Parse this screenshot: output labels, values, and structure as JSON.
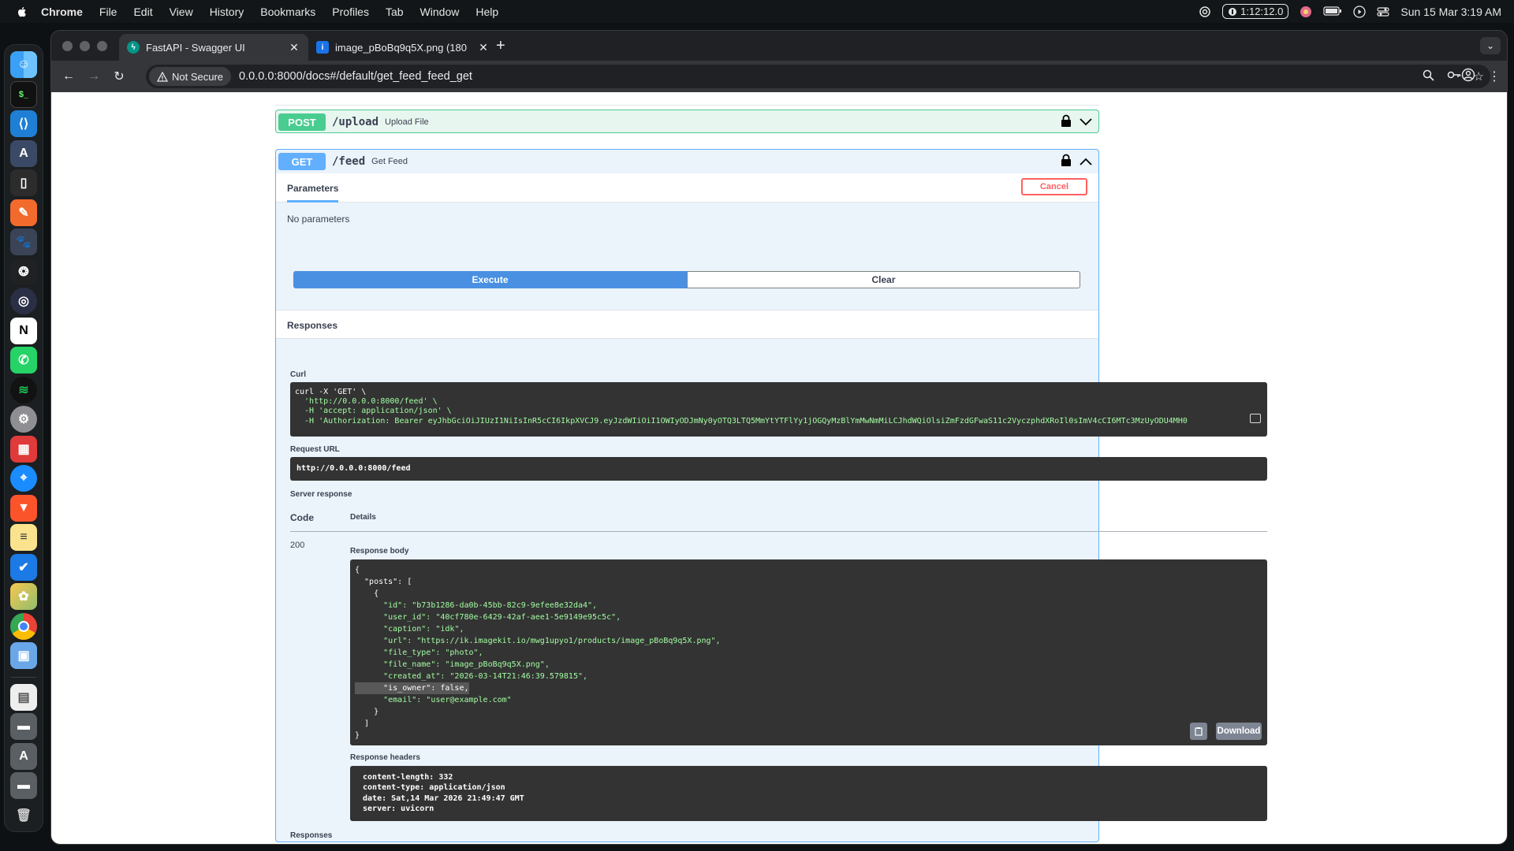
{
  "menubar": {
    "app_name": "Chrome",
    "items": [
      "File",
      "Edit",
      "View",
      "History",
      "Bookmarks",
      "Profiles",
      "Tab",
      "Window",
      "Help"
    ],
    "timer": "1:12:12.0",
    "datetime": "Sun 15 Mar  3:19 AM"
  },
  "browser": {
    "tabs": [
      {
        "title": "FastAPI - Swagger UI",
        "favicon": "fastapi-icon",
        "active": true
      },
      {
        "title": "image_pBoBq9q5X.png (180",
        "favicon": "info-icon",
        "active": false
      }
    ],
    "security_chip": "Not Secure",
    "url": "0.0.0.0:8000/docs#/default/get_feed_feed_get"
  },
  "swagger": {
    "post_op": {
      "method": "POST",
      "path": "/upload",
      "summary": "Upload File"
    },
    "get_op": {
      "method": "GET",
      "path": "/feed",
      "summary": "Get Feed"
    },
    "parameters_tab": "Parameters",
    "cancel_label": "Cancel",
    "no_params": "No parameters",
    "execute_label": "Execute",
    "clear_label": "Clear",
    "responses_title": "Responses",
    "curl_label": "Curl",
    "curl_lines": [
      "curl -X 'GET' \\",
      "  'http://0.0.0.0:8000/feed' \\",
      "  -H 'accept: application/json' \\",
      "  -H 'Authorization: Bearer eyJhbGciOiJIUzI1NiIsInR5cCI6IkpXVCJ9.eyJzdWIiOiI1OWIyODJmNy0yOTQ3LTQ5MmYtYTFlYy1jOGQyMzBlYmMwNmMiLCJhdWQiOlsiZmFzdGFwaS11c2VyczphdXRoIl0sImV4cCI6MTc3MzUyODU4MH0"
    ],
    "request_url_label": "Request URL",
    "request_url": "http://0.0.0.0:8000/feed",
    "server_response_label": "Server response",
    "code_header": "Code",
    "details_header": "Details",
    "status_code": "200",
    "response_body_label": "Response body",
    "response_body_lines": [
      "{",
      "  \"posts\": [",
      "    {",
      "      \"id\": \"b73b1286-da0b-45bb-82c9-9efee8e32da4\",",
      "      \"user_id\": \"40cf780e-6429-42af-aee1-5e9149e95c5c\",",
      "      \"caption\": \"idk\",",
      "      \"url\": \"https://ik.imagekit.io/mwg1upyo1/products/image_pBoBq9q5X.png\",",
      "      \"file_type\": \"photo\",",
      "      \"file_name\": \"image_pBoBq9q5X.png\",",
      "      \"created_at\": \"2026-03-14T21:46:39.579815\",",
      "      \"is_owner\": false,",
      "      \"email\": \"user@example.com\"",
      "    }",
      "  ]",
      "}"
    ],
    "download_label": "Download",
    "response_headers_label": "Response headers",
    "response_headers_lines": [
      " content-length: 332",
      " content-type: application/json",
      " date: Sat,14 Mar 2026 21:49:47 GMT",
      " server: uvicorn"
    ],
    "responses_bottom": "Responses"
  },
  "colors": {
    "post": "#49cc90",
    "get": "#61affe",
    "execute": "#4990e2",
    "cancel": "#ff6060",
    "code_bg": "#333333",
    "string": "#a2fca2"
  }
}
